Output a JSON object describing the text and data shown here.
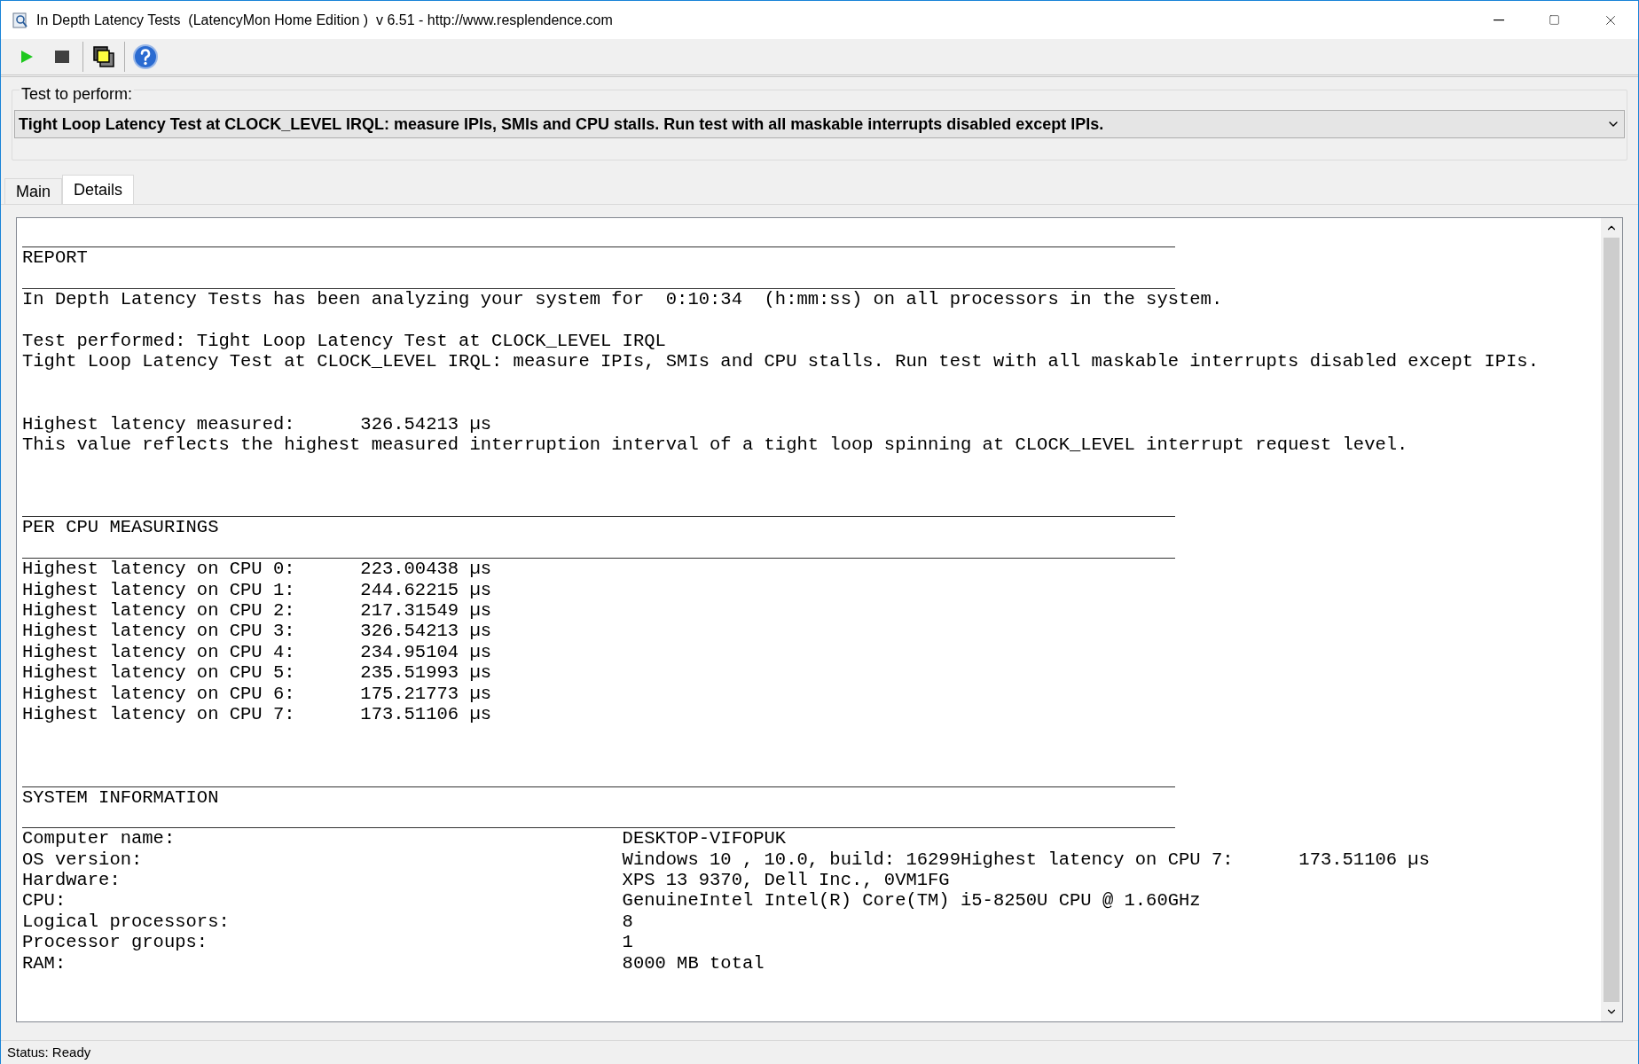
{
  "window": {
    "title": "In Depth Latency Tests  (LatencyMon Home Edition )  v 6.51 - http://www.resplendence.com"
  },
  "test_group": {
    "label": "Test to perform:",
    "value": "Tight Loop Latency Test at CLOCK_LEVEL IRQL: measure IPIs, SMIs and CPU stalls. Run test with all maskable interrupts disabled except IPIs."
  },
  "tabs": [
    {
      "label": "Main",
      "selected": false
    },
    {
      "label": "Details",
      "selected": true
    }
  ],
  "report_lines": [
    {
      "kind": "rule"
    },
    {
      "kind": "text",
      "text": "REPORT"
    },
    {
      "kind": "rule"
    },
    {
      "kind": "text",
      "text": "In Depth Latency Tests has been analyzing your system for  0:10:34  (h:mm:ss) on all processors in the system."
    },
    {
      "kind": "blank"
    },
    {
      "kind": "text",
      "text": "Test performed: Tight Loop Latency Test at CLOCK_LEVEL IRQL"
    },
    {
      "kind": "text",
      "text": "Tight Loop Latency Test at CLOCK_LEVEL IRQL: measure IPIs, SMIs and CPU stalls. Run test with all maskable interrupts disabled except IPIs."
    },
    {
      "kind": "blank"
    },
    {
      "kind": "blank"
    },
    {
      "kind": "text",
      "text": "Highest latency measured:      326.54213 µs"
    },
    {
      "kind": "text",
      "text": "This value reflects the highest measured interruption interval of a tight loop spinning at CLOCK_LEVEL interrupt request level."
    },
    {
      "kind": "blank"
    },
    {
      "kind": "blank"
    },
    {
      "kind": "rule"
    },
    {
      "kind": "text",
      "text": "PER CPU MEASURINGS"
    },
    {
      "kind": "rule"
    },
    {
      "kind": "text",
      "text": "Highest latency on CPU 0:      223.00438 µs"
    },
    {
      "kind": "text",
      "text": "Highest latency on CPU 1:      244.62215 µs"
    },
    {
      "kind": "text",
      "text": "Highest latency on CPU 2:      217.31549 µs"
    },
    {
      "kind": "text",
      "text": "Highest latency on CPU 3:      326.54213 µs"
    },
    {
      "kind": "text",
      "text": "Highest latency on CPU 4:      234.95104 µs"
    },
    {
      "kind": "text",
      "text": "Highest latency on CPU 5:      235.51993 µs"
    },
    {
      "kind": "text",
      "text": "Highest latency on CPU 6:      175.21773 µs"
    },
    {
      "kind": "text",
      "text": "Highest latency on CPU 7:      173.51106 µs"
    },
    {
      "kind": "blank"
    },
    {
      "kind": "blank"
    },
    {
      "kind": "rule"
    },
    {
      "kind": "text",
      "text": "SYSTEM INFORMATION"
    },
    {
      "kind": "rule"
    },
    {
      "kind": "pair",
      "label": "Computer name:",
      "value": "DESKTOP-VIFOPUK"
    },
    {
      "kind": "pair",
      "label": "OS version:",
      "value": "Windows 10 , 10.0, build: 16299Highest latency on CPU 7:      173.51106 µs"
    },
    {
      "kind": "pair",
      "label": "Hardware:",
      "value": "XPS 13 9370, Dell Inc., 0VM1FG"
    },
    {
      "kind": "pair",
      "label": "CPU:",
      "value": "GenuineIntel Intel(R) Core(TM) i5-8250U CPU @ 1.60GHz"
    },
    {
      "kind": "pair",
      "label": "Logical processors:",
      "value": "8"
    },
    {
      "kind": "pair",
      "label": "Processor groups:",
      "value": "1"
    },
    {
      "kind": "pair",
      "label": "RAM:",
      "value": "8000 MB total"
    }
  ],
  "status_bar": {
    "text": "Status: Ready"
  }
}
